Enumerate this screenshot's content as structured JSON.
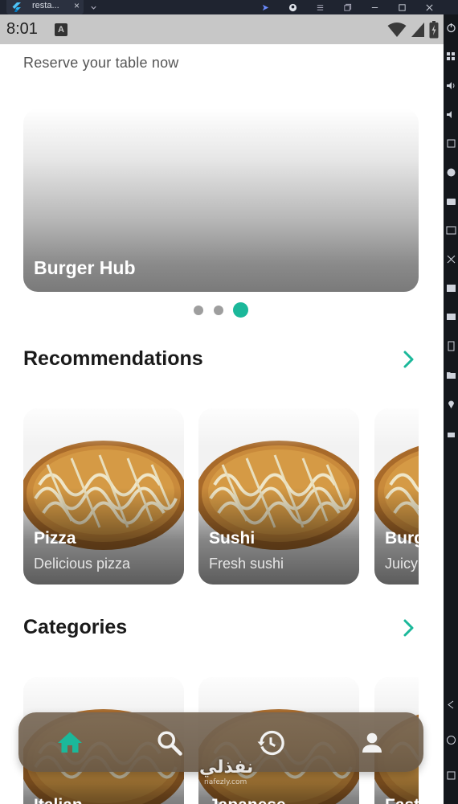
{
  "host": {
    "tab_title": "resta...",
    "tab_close": "×"
  },
  "status_bar": {
    "time": "8:01",
    "notification_badge": "A"
  },
  "home": {
    "subtitle": "Reserve your table now",
    "carousel": {
      "title": "Burger Hub",
      "page_count": 3,
      "active_index": 2
    },
    "recommendations": {
      "title": "Recommendations",
      "items": [
        {
          "name": "Pizza",
          "description": "Delicious pizza"
        },
        {
          "name": "Sushi",
          "description": "Fresh sushi"
        },
        {
          "name": "Burg",
          "description": "Juicy"
        }
      ]
    },
    "categories": {
      "title": "Categories",
      "items": [
        {
          "name": "Italian"
        },
        {
          "name": "Japanese"
        },
        {
          "name": "Fast"
        }
      ]
    }
  },
  "bottom_nav": {
    "items": [
      {
        "icon": "home-icon",
        "active": true
      },
      {
        "icon": "search-icon",
        "active": false
      },
      {
        "icon": "history-icon",
        "active": false
      },
      {
        "icon": "profile-icon",
        "active": false
      }
    ]
  },
  "watermark": {
    "text": "نفذلي",
    "sub": "nafezly.com"
  },
  "colors": {
    "accent": "#1bb89a",
    "nav_bg": "#786856",
    "status_bar": "#c7c7c7"
  }
}
